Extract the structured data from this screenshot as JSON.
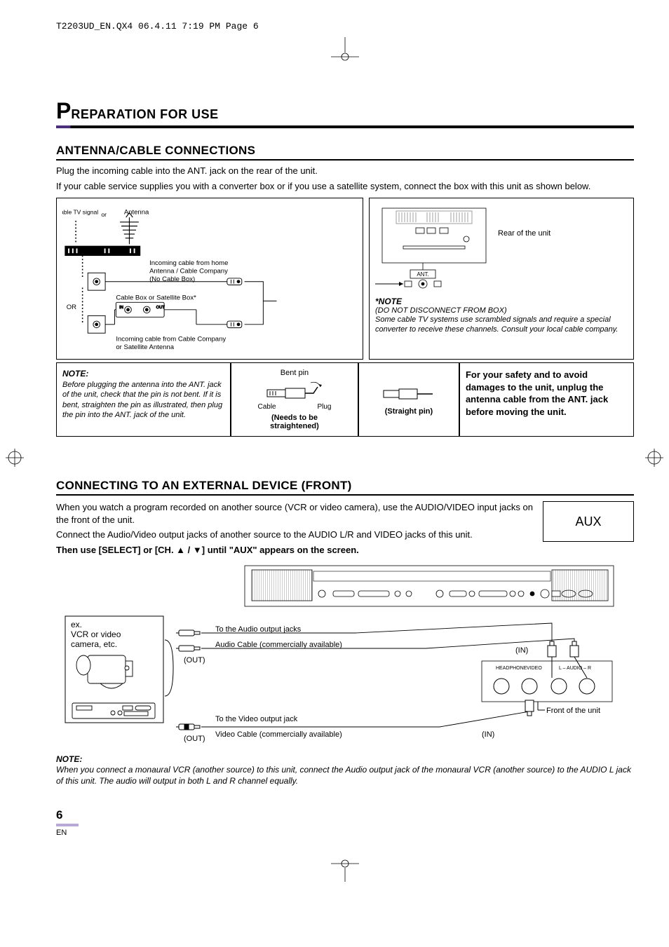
{
  "printHeader": "T2203UD_EN.QX4  06.4.11  7:19 PM  Page 6",
  "title": {
    "first": "P",
    "rest": "REPARATION FOR USE"
  },
  "section1": {
    "heading": "ANTENNA/CABLE CONNECTIONS",
    "intro1": "Plug the incoming cable into the ANT. jack on the rear of the unit.",
    "intro2": "If your cable service supplies you with a converter box or if you use a satellite system, connect the box with this unit as shown below.",
    "leftPanel": {
      "cableTvSignal": "Cable TV signal",
      "or1": "or",
      "antenna": "Antenna",
      "incoming1a": "Incoming cable from home",
      "incoming1b": "Antenna / Cable Company",
      "incoming1c": "(No Cable Box)",
      "cableBox": "Cable Box or Satellite Box*",
      "or2": "OR",
      "in": "IN",
      "out": "OUT",
      "incoming2a": "Incoming cable from Cable Company",
      "incoming2b": "or Satellite Antenna"
    },
    "rightPanel": {
      "rear": "Rear of the unit",
      "ant": "ANT.",
      "noteHead": "*NOTE",
      "note1": "(DO NOT DISCONNECT FROM BOX)",
      "note2": "Some cable TV systems use scrambled signals and require a special converter to receive these channels. Consult your local cable company."
    },
    "noteRow": {
      "noteHead": "NOTE:",
      "noteBody": "Before plugging the antenna into the ANT. jack of the unit, check that the pin is not bent. If it is bent, straighten the pin as illustrated, then plug the pin into the ANT. jack of the unit.",
      "bentPin": "Bent pin",
      "cable": "Cable",
      "plug": "Plug",
      "needs1": "(Needs to be",
      "needs2": "straightened)",
      "straight": "(Straight pin)",
      "safety": "For your safety and to avoid damages to the unit, unplug the antenna cable from the ANT. jack before moving the unit."
    }
  },
  "section2": {
    "heading": "CONNECTING TO AN EXTERNAL DEVICE (FRONT)",
    "p1": "When you watch a program recorded on another source (VCR or video camera), use the AUDIO/VIDEO input jacks on the front of the unit.",
    "p2": "Connect the Audio/Video output jacks of another source to the AUDIO L/R and VIDEO jacks of this unit.",
    "p3a": "Then use [SELECT] or [CH. ",
    "p3b": " / ",
    "p3c": "] until \"AUX\" appears on the screen.",
    "aux": "AUX",
    "diag": {
      "ex": "ex.",
      "vcr1": "VCR or video",
      "vcr2": "camera, etc.",
      "toAudio": "To the Audio output jacks",
      "audioCable": "Audio Cable (commercially available)",
      "out": "(OUT)",
      "in": "(IN)",
      "headphone": "HEADPHONE",
      "video": "VIDEO",
      "audioLR": "L – AUDIO – R",
      "front": "Front of the unit",
      "toVideo": "To the Video output jack",
      "videoCable": "Video Cable (commercially available)"
    },
    "note": {
      "head": "NOTE:",
      "body": "When you connect a monaural VCR (another source) to this unit, connect the Audio output jack of the monaural VCR (another source) to the AUDIO L jack of this unit. The audio will output in both L and R channel equally."
    }
  },
  "pageNumber": {
    "num": "6",
    "en": "EN"
  }
}
